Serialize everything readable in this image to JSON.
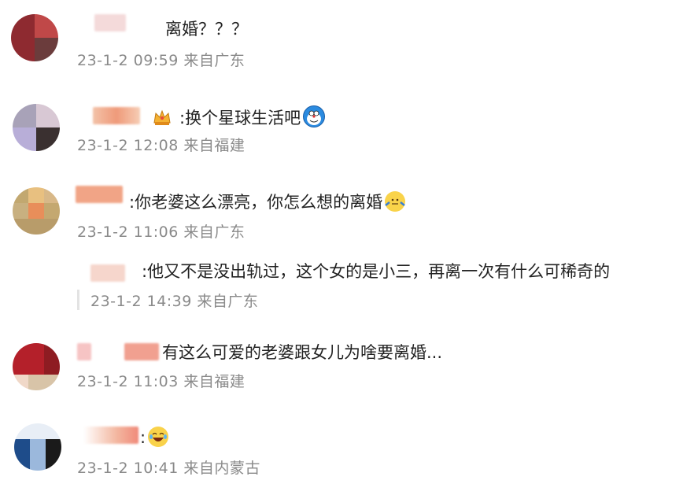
{
  "comments": [
    {
      "text": "离婚？？？",
      "time": "23-1-2 09:59",
      "location": "来自广东"
    },
    {
      "text": ":换个星球生活吧",
      "time": "23-1-2 12:08",
      "location": "来自福建"
    },
    {
      "text": ":你老婆这么漂亮，你怎么想的离婚",
      "time": "23-1-2 11:06",
      "location": "来自广东"
    },
    {
      "text": ":他又不是没出轨过，这个女的是小三，再离一次有什么可稀奇的",
      "time": "23-1-2 14:39",
      "location": "来自广东"
    },
    {
      "text": "有这么可爱的老婆跟女儿为啥要离婚...",
      "time": "23-1-2 11:03",
      "location": "来自福建"
    },
    {
      "text": ":",
      "time": "23-1-2 10:41",
      "location": "来自内蒙古"
    }
  ],
  "icons": {
    "doraemon": "doraemon-emoji-icon",
    "shrug": "shrug-emoji-icon",
    "laugh_cry": "laugh-cry-emoji-icon",
    "crown": "crown-badge-icon"
  },
  "colors": {
    "meta": "#8a8a8a",
    "text": "#222222"
  }
}
